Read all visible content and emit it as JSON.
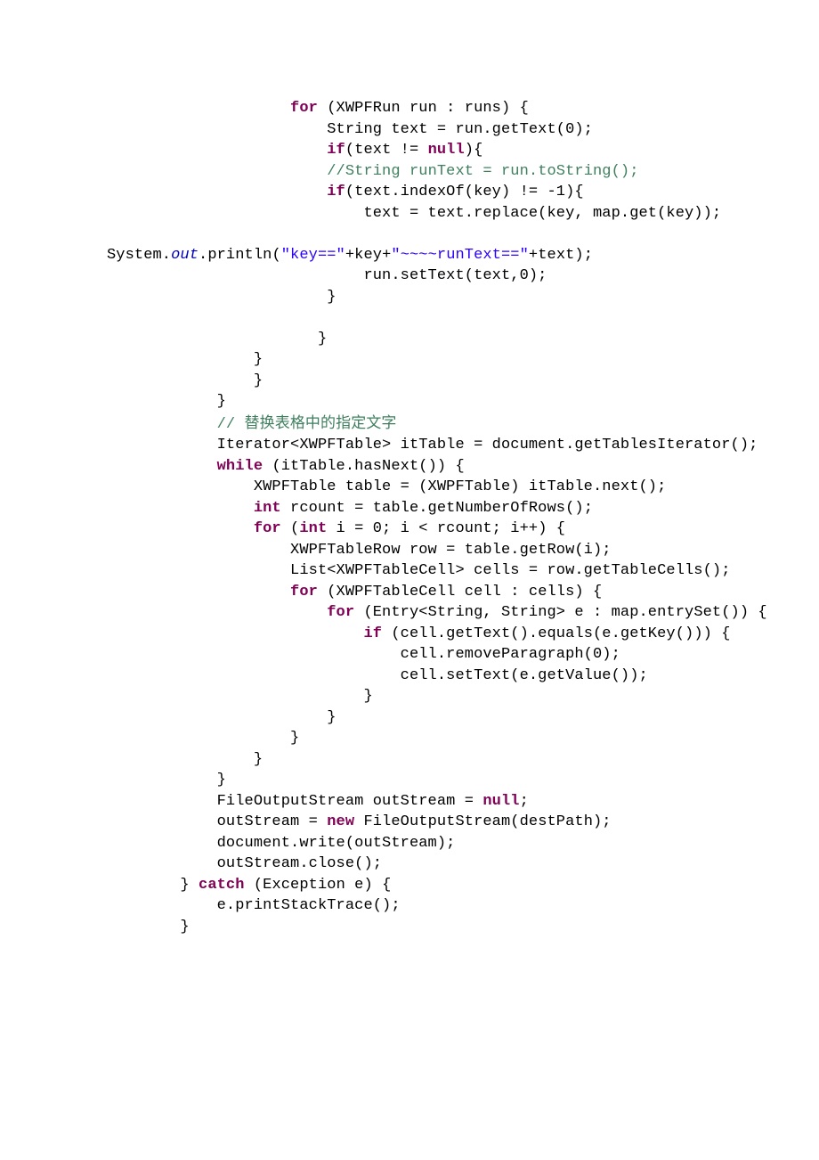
{
  "l0": "                    ",
  "l0k": "for",
  "l0t": " (XWPFRun run : runs) {",
  "l1": "                        String text = run.getText(0);",
  "l2a": "                        ",
  "l2k1": "if",
  "l2b": "(text != ",
  "l2k2": "null",
  "l2c": "){",
  "l3a": "                        ",
  "l3c": "//String runText = run.toString();",
  "l4a": "                        ",
  "l4k": "if",
  "l4b": "(text.indexOf(key) != -1){",
  "l5": "                            text = text.replace(key, map.get(key));",
  "blank": "",
  "l6a": "System.",
  "l6o": "out",
  "l6b": ".println(",
  "l6s1": "\"key==\"",
  "l6c": "+key+",
  "l6s2": "\"~~~~runText==\"",
  "l6d": "+text);",
  "l7": "                            run.setText(text,0);",
  "l8": "                        }",
  "l9": "                       }",
  "l10": "                }",
  "l10b": "                }",
  "l11": "            }",
  "l12a": "            ",
  "l12c": "// ",
  "l12cjk": "替换表格中的指定文字",
  "l13": "            Iterator<XWPFTable> itTable = document.getTablesIterator();",
  "l14a": "            ",
  "l14k": "while",
  "l14b": " (itTable.hasNext()) {",
  "l15": "                XWPFTable table = (XWPFTable) itTable.next();",
  "l16a": "                ",
  "l16k": "int",
  "l16b": " rcount = table.getNumberOfRows();",
  "l17a": "                ",
  "l17k1": "for",
  "l17b": " (",
  "l17k2": "int",
  "l17c": " i = 0; i < rcount; i++) {",
  "l18": "                    XWPFTableRow row = table.getRow(i);",
  "l19": "                    List<XWPFTableCell> cells = row.getTableCells();",
  "l20a": "                    ",
  "l20k": "for",
  "l20b": " (XWPFTableCell cell : cells) {",
  "l21a": "                        ",
  "l21k": "for",
  "l21b": " (Entry<String, String> e : map.entrySet()) {",
  "l22a": "                            ",
  "l22k": "if",
  "l22b": " (cell.getText().equals(e.getKey())) {",
  "l23": "                                cell.removeParagraph(0);",
  "l24": "                                cell.setText(e.getValue());",
  "l25": "                            }",
  "l26": "                        }",
  "l27": "                    }",
  "l28": "                }",
  "l29": "            }",
  "l30a": "            FileOutputStream outStream = ",
  "l30k": "null",
  "l30b": ";",
  "l31a": "            outStream = ",
  "l31k": "new",
  "l31b": " FileOutputStream(destPath);",
  "l32": "            document.write(outStream);",
  "l33": "            outStream.close();",
  "l34a": "        } ",
  "l34k": "catch",
  "l34b": " (Exception e) {",
  "l35": "            e.printStackTrace();",
  "l36": "        }"
}
